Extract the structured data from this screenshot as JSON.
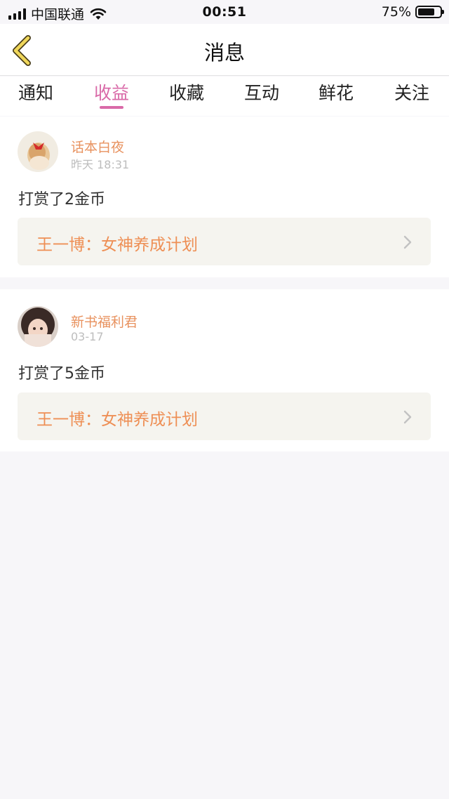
{
  "status_bar": {
    "carrier": "中国联通",
    "time": "00:51",
    "battery_percent": "75%",
    "battery_level": 0.75,
    "signal_icon": "signal-bars-icon",
    "wifi_icon": "wifi-icon",
    "battery_icon": "battery-icon"
  },
  "nav": {
    "title": "消息",
    "back_icon": "chevron-left-icon"
  },
  "tabs": [
    {
      "label": "通知",
      "active": false
    },
    {
      "label": "收益",
      "active": true
    },
    {
      "label": "收藏",
      "active": false
    },
    {
      "label": "互动",
      "active": false
    },
    {
      "label": "鲜花",
      "active": false
    },
    {
      "label": "关注",
      "active": false
    }
  ],
  "messages": [
    {
      "username": "话本白夜",
      "time": "昨天 18:31",
      "text": "打赏了2金币",
      "book_title": "王一博：女神养成计划"
    },
    {
      "username": "新书福利君",
      "time": "03-17",
      "text": "打赏了5金币",
      "book_title": "王一博：女神养成计划"
    }
  ],
  "colors": {
    "accent": "#d96aa8",
    "username": "#e8925f",
    "book_title": "#ee8f55",
    "back_icon": "#f0d75a"
  }
}
